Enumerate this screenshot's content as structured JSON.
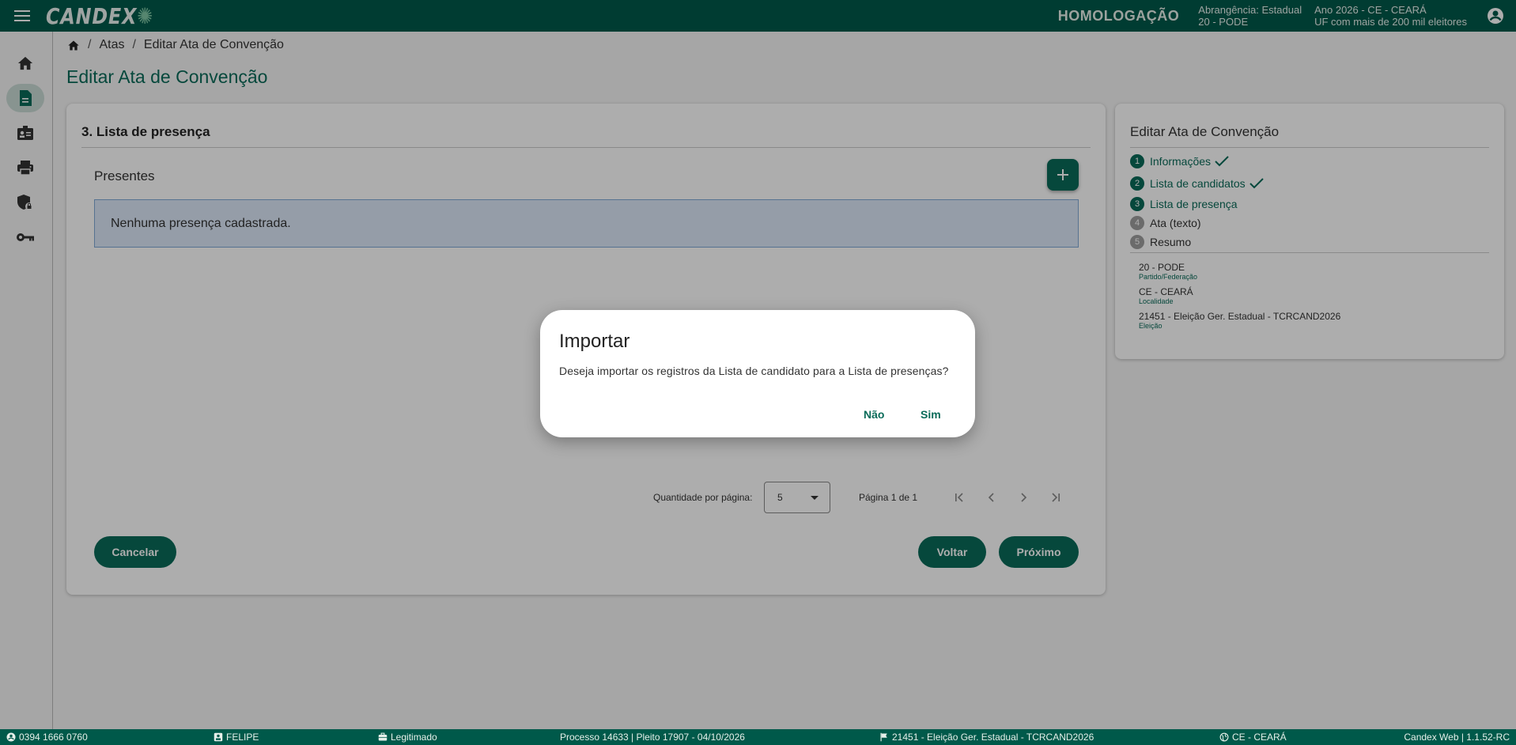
{
  "topbar": {
    "logo": "CANDEX",
    "environment": "HOMOLOGAÇÃO",
    "scope_line1": "Abrangência: Estadual",
    "scope_line2": "20 - PODE",
    "year_line1": "Ano 2026 - CE - CEARÁ",
    "year_line2": "UF com mais de 200 mil eleitores",
    "icons": {
      "menu": "hamburger-icon",
      "user": "account-circle-icon"
    }
  },
  "sidebar": {
    "items": [
      {
        "icon": "home-icon",
        "active": false
      },
      {
        "icon": "document-icon",
        "active": true
      },
      {
        "icon": "id-badge-icon",
        "active": false
      },
      {
        "icon": "printer-icon",
        "active": false
      },
      {
        "icon": "shield-lock-icon",
        "active": false
      },
      {
        "icon": "key-icon",
        "active": false
      }
    ]
  },
  "breadcrumb": {
    "items": [
      "Atas",
      "Editar Ata de Convenção"
    ],
    "separator": "/"
  },
  "page": {
    "title": "Editar Ata de Convenção"
  },
  "main_card": {
    "section_title": "3. Lista de presença",
    "subsection": "Presentes",
    "empty_message": "Nenhuma presença cadastrada.",
    "pager": {
      "per_page_label": "Quantidade por página:",
      "per_page_value": "5",
      "page_info": "Página 1 de 1"
    },
    "buttons": {
      "cancel": "Cancelar",
      "back": "Voltar",
      "next": "Próximo"
    }
  },
  "stepper": {
    "title": "Editar Ata de Convenção",
    "steps": [
      {
        "num": "1",
        "label": "Informações",
        "status": "done",
        "checked": true
      },
      {
        "num": "2",
        "label": "Lista de candidatos",
        "status": "done",
        "checked": true
      },
      {
        "num": "3",
        "label": "Lista de presença",
        "status": "current",
        "checked": false
      },
      {
        "num": "4",
        "label": "Ata (texto)",
        "status": "todo",
        "checked": false
      },
      {
        "num": "5",
        "label": "Resumo",
        "status": "todo",
        "checked": false
      }
    ],
    "info": [
      {
        "value": "20 - PODE",
        "key": "Partido/Federação"
      },
      {
        "value": "CE - CEARÁ",
        "key": "Localidade"
      },
      {
        "value": "21451 - Eleição Ger. Estadual - TCRCAND2026",
        "key": "Eleição"
      }
    ]
  },
  "dialog": {
    "title": "Importar",
    "message": "Deseja importar os registros da Lista de candidato para a Lista de presenças?",
    "no": "Não",
    "yes": "Sim"
  },
  "footer": {
    "phone": "0394 1666 0760",
    "user": "FELIPE",
    "status": "Legitimado",
    "process": "Processo 14633 | Pleito 17907 - 04/10/2026",
    "election": "21451 - Eleição Ger. Estadual - TCRCAND2026",
    "location": "CE - CEARÁ",
    "version": "Candex Web | 1.1.52-RC"
  },
  "colors": {
    "brand": "#00594a",
    "accent": "#0a6b59",
    "info_bg": "#dce8f8"
  }
}
